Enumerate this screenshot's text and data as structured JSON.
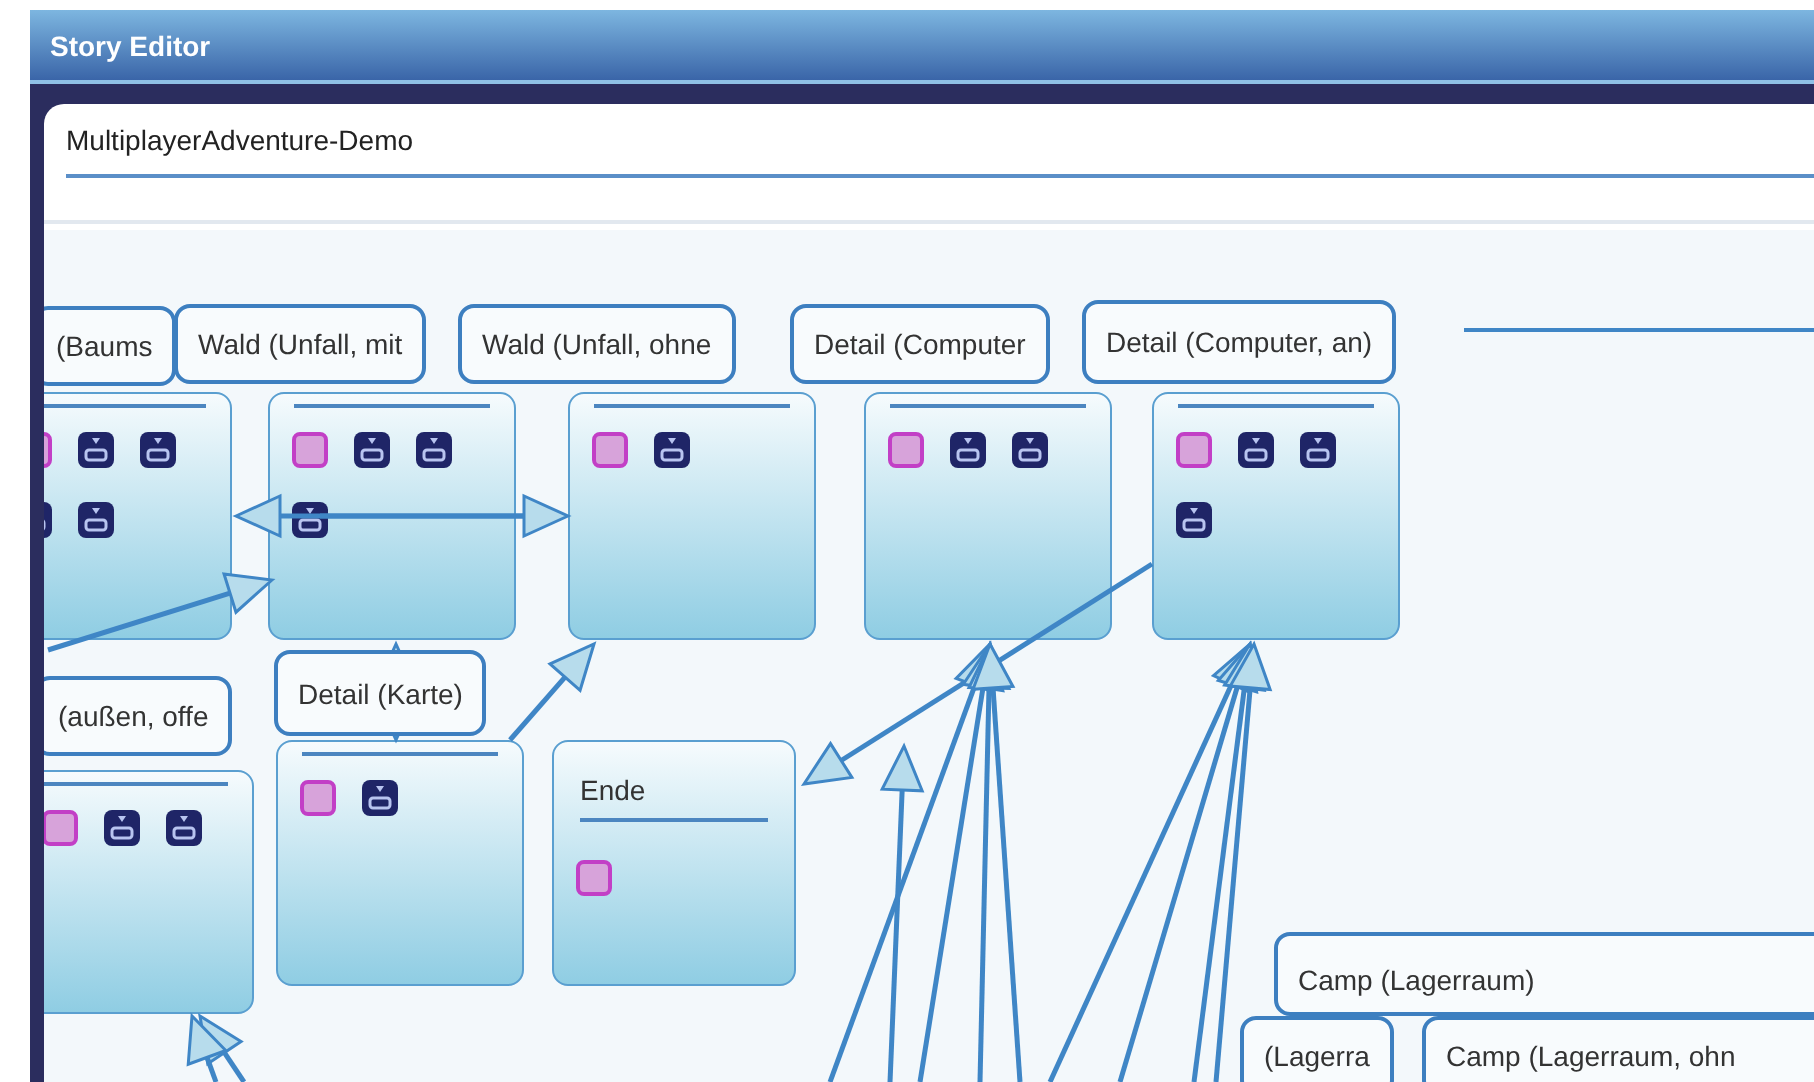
{
  "window": {
    "title": "Story Editor"
  },
  "story_title": {
    "value": "MultiplayerAdventure-Demo"
  },
  "nodes": [
    {
      "kind": "tabbed",
      "label": "(Baums",
      "icons": [
        {
          "kind": "square"
        },
        {
          "kind": "tray"
        },
        {
          "kind": "tray"
        },
        {
          "kind": "tray"
        },
        {
          "kind": "tray"
        }
      ]
    },
    {
      "kind": "tabbed",
      "label": "Wald (Unfall, mit",
      "icons": [
        {
          "kind": "square"
        },
        {
          "kind": "tray"
        },
        {
          "kind": "tray"
        },
        {
          "kind": "tray"
        }
      ]
    },
    {
      "kind": "tabbed",
      "label": "Wald (Unfall, ohne",
      "icons": [
        {
          "kind": "square"
        },
        {
          "kind": "tray"
        }
      ]
    },
    {
      "kind": "tabbed",
      "label": "Detail (Computer",
      "icons": [
        {
          "kind": "square"
        },
        {
          "kind": "tray"
        },
        {
          "kind": "tray"
        }
      ]
    },
    {
      "kind": "tabbed",
      "label": "Detail (Computer, an)",
      "icons": [
        {
          "kind": "square"
        },
        {
          "kind": "tray"
        },
        {
          "kind": "tray"
        },
        {
          "kind": "tray"
        }
      ]
    },
    {
      "kind": "tabbed",
      "label": "(außen, offe",
      "icons": [
        {
          "kind": "square"
        },
        {
          "kind": "tray"
        },
        {
          "kind": "tray"
        }
      ]
    },
    {
      "kind": "tabbed",
      "label": "Detail (Karte)",
      "icons": [
        {
          "kind": "square"
        },
        {
          "kind": "tray"
        }
      ]
    },
    {
      "kind": "titled",
      "label": "Ende",
      "icons": [
        {
          "kind": "square"
        }
      ]
    },
    {
      "kind": "tab_only",
      "label": "Camp (Lagerraum)"
    },
    {
      "kind": "tab_only",
      "label": "(Lagerra"
    },
    {
      "kind": "tab_only",
      "label": "Camp (Lagerraum, ohn"
    }
  ]
}
